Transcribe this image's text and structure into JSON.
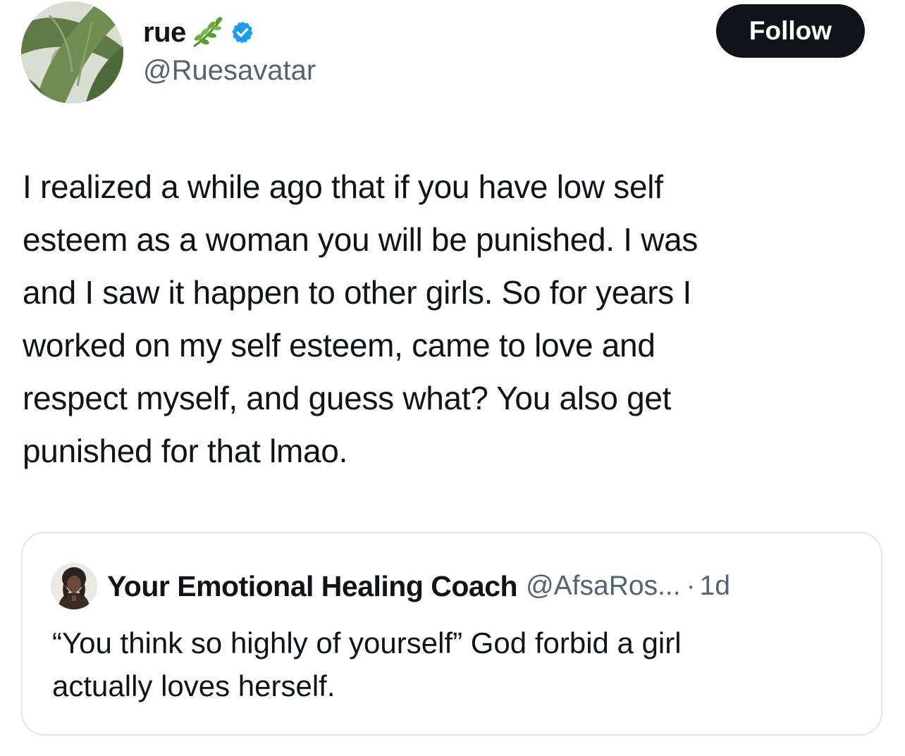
{
  "author": {
    "display_name": "rue",
    "handle": "@Ruesavatar",
    "emoji_icon": "herb-icon",
    "verified_icon": "verified-badge-icon",
    "verified_color": "#1d9bf0"
  },
  "follow_button": {
    "label": "Follow",
    "background": "#0f1419",
    "text_color": "#ffffff"
  },
  "tweet": {
    "text": "I realized a while ago that if you have low self\nesteem as a woman you will be punished. I was\nand I saw it happen to other girls. So for years I\nworked on my self esteem, came to love and\nrespect myself, and guess what? You also get\npunished for that lmao."
  },
  "quoted_tweet": {
    "display_name": "Your Emotional Healing Coach",
    "handle": "@AfsaRos...",
    "separator": "·",
    "time": "1d",
    "text": "“You think so highly of yourself” God forbid a girl\nactually loves herself."
  },
  "colors": {
    "text_primary": "#0f1419",
    "text_secondary": "#536471",
    "card_border": "#e3e7ea"
  }
}
